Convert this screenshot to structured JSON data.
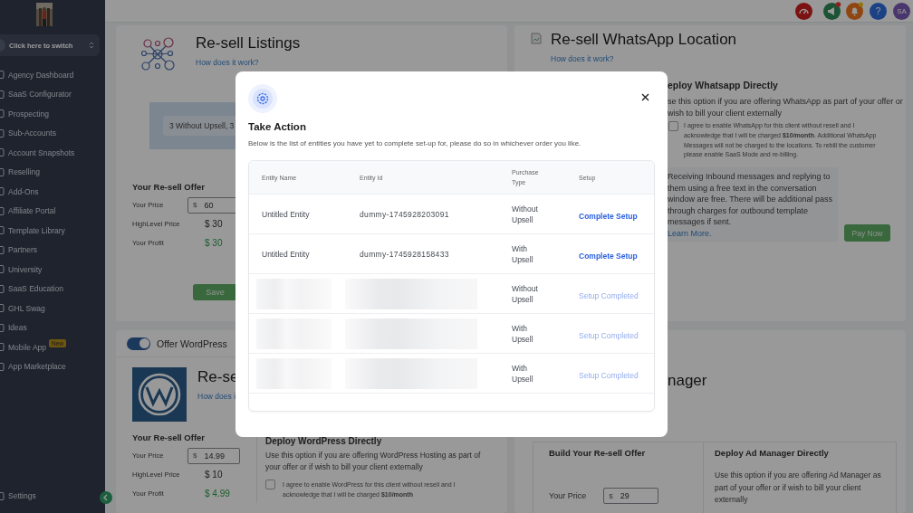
{
  "sidebar": {
    "switcher": "Click here to switch",
    "items": [
      {
        "label": "Agency Dashboard"
      },
      {
        "label": "SaaS Configurator"
      },
      {
        "label": "Prospecting"
      },
      {
        "label": "Sub-Accounts"
      },
      {
        "label": "Account Snapshots"
      },
      {
        "label": "Reselling"
      },
      {
        "label": "Add-Ons"
      },
      {
        "label": "Affiliate Portal"
      },
      {
        "label": "Template Library"
      },
      {
        "label": "Partners"
      },
      {
        "label": "University"
      },
      {
        "label": "SaaS Education"
      },
      {
        "label": "GHL Swag"
      },
      {
        "label": "Ideas"
      },
      {
        "label": "Mobile App",
        "badge": "New"
      },
      {
        "label": "App Marketplace"
      }
    ],
    "settings": "Settings"
  },
  "header": {
    "help": "?",
    "avatar": "SA"
  },
  "listings_card": {
    "title": "Re-sell Listings",
    "link": "How does it work?",
    "summary": "3 Without Upsell, 3",
    "offer": {
      "heading": "Your Re-sell Offer",
      "price_label": "Your Price",
      "currency": "$",
      "price": "60",
      "highlevel_label": "HighLevel Price",
      "highlevel_price": "$ 30",
      "profit_label": "Your Profit",
      "profit": "$ 30"
    },
    "save": "Save"
  },
  "whatsapp_card": {
    "title": "Re-sell WhatsApp Location",
    "link": "How does it work?",
    "deploy_heading": "eploy Whatsapp Directly",
    "deploy_lines": [
      "se this option if you are offering WhatsApp as part of your offer or",
      "wish to bill your client externally"
    ],
    "checked": false,
    "agreement": "I agree to enable WhatsApp for this client without resell and I acknowledge that I will be charged **$10/month**. Additional WhatsApp Messages will not be charged to the locations. To rebill the customer please enable SaaS Mode and re-billing.",
    "info": "Receiving Inbound messages and replying to them using a free text in the conversation window are free. There will be additional pass through charges for outbound template messages if sent.",
    "learn_more": "Learn More.",
    "pay": "Pay Now"
  },
  "wordpress_card": {
    "toggle_label": "Offer WordPress",
    "enabled": true,
    "title": "Re-se",
    "link": "How does i",
    "offer": {
      "heading": "Your Re-sell Offer",
      "price_label": "Your Price",
      "currency": "$",
      "price": "14.99",
      "highlevel_label": "HighLevel Price",
      "highlevel_price": "$ 10",
      "profit_label": "Your Profit",
      "profit": "$ 4.99"
    },
    "deploy_heading": "Deploy WordPress Directly",
    "deploy_text": "Use this option if you are offering WordPress Hosting as part of your offer or if wish to bill your client externally",
    "checked": false,
    "agreement": "I agree to enable WordPress for this client without resell and I acknowledge that I will be charged **$10/month**"
  },
  "admanager_card": {
    "title": "nager",
    "build_heading": "Build Your Re-sell Offer",
    "price_label": "Your Price",
    "currency": "$",
    "price": "29",
    "deploy_heading": "Deploy Ad Manager Directly",
    "deploy_text": "Use this option if you are offering Ad Manager as part of your offer or if wish to bill your client externally"
  },
  "modal": {
    "title": "Take Action",
    "description": "Below is the list of entities you have yet to complete set-up for, please do so in whichever order you like.",
    "columns": [
      "Entity Name",
      "Entity Id",
      "Purchase Type",
      "Setup"
    ],
    "rows": [
      {
        "name": "Untitled Entity",
        "id": "dummy-1745928203091",
        "purchase_type": "Without Upsell",
        "setup": "Complete Setup",
        "completed": false
      },
      {
        "name": "Untitled Entity",
        "id": "dummy-1745928158433",
        "purchase_type": "With Upsell",
        "setup": "Complete Setup",
        "completed": false
      },
      {
        "redacted": true,
        "purchase_type": "Without Upsell",
        "setup": "Setup Completed",
        "completed": true
      },
      {
        "redacted": true,
        "purchase_type": "With Upsell",
        "setup": "Setup Completed",
        "completed": true
      },
      {
        "redacted": true,
        "purchase_type": "With Upsell",
        "setup": "Setup Completed",
        "completed": true
      }
    ]
  }
}
